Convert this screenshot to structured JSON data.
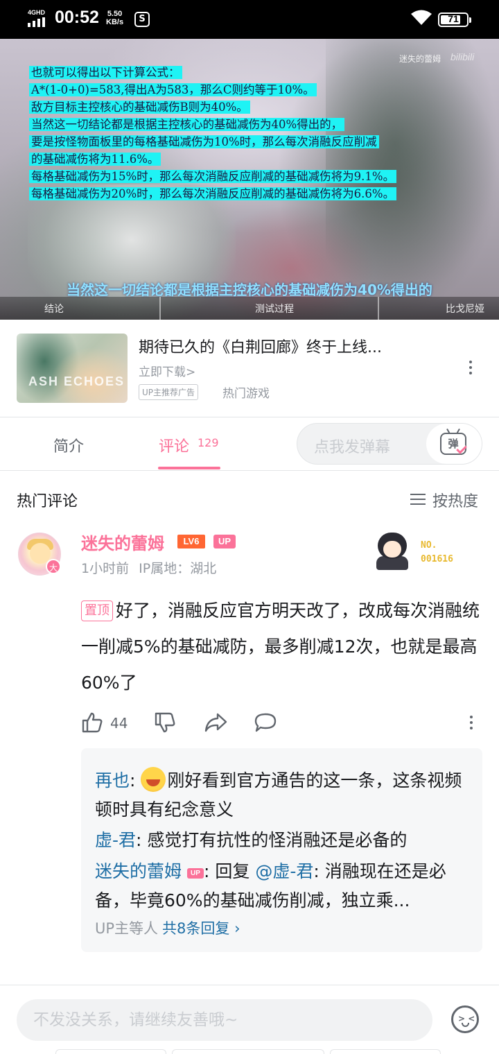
{
  "status_bar": {
    "network": "4GHD",
    "time": "00:52",
    "speed_value": "5.50",
    "speed_unit": "KB/s",
    "battery": "71"
  },
  "video": {
    "watermark": "迷失的蕾姆",
    "logo": "bilibili",
    "formula_lines": [
      "也就可以得出以下计算公式：",
      "A*(1-0+0)=583,得出A为583，那么C则约等于10%。",
      "敌方目标主控核心的基础减伤B则为40%。",
      "当然这一切结论都是根据主控核心的基础减伤为40%得出的，",
      "要是按怪物面板里的每格基础减伤为10%时，那么每次消融反应削减",
      "的基础减伤将为11.6%。",
      "每格基础减伤为15%时，那么每次消融反应削减的基础减伤将为9.1%。",
      "每格基础减伤为20%时，那么每次消融反应削减的基础减伤将为6.6%。"
    ],
    "subtitle": "当然这一切结论都是根据主控核心的基础减伤为40%得出的",
    "chapters": [
      "结论",
      "测试过程",
      "比戈尼娅"
    ]
  },
  "ad": {
    "thumb_text": "ASH ECHOES",
    "title": "期待已久的《白荆回廊》终于上线...",
    "link": "立即下载>",
    "tag": "UP主推荐广告",
    "category": "热门游戏"
  },
  "tabs": {
    "intro": "简介",
    "comments": "评论",
    "comment_count": "129",
    "danmaku_placeholder": "点我发弹幕",
    "danmaku_icon_text": "弹"
  },
  "comments_header": {
    "title": "热门评论",
    "sort": "按热度"
  },
  "comment": {
    "username": "迷失的蕾姆",
    "level": "LV6",
    "up_badge": "UP",
    "avatar_badge": "大",
    "time": "1小时前",
    "ip": "IP属地：湖北",
    "fan_no_label": "NO.",
    "fan_no": "001616",
    "pin_label": "置顶",
    "text": "好了，消融反应官方明天改了，改成每次消融统一削减5%的基础减防，最多削减12次，也就是最高60%了",
    "likes": "44"
  },
  "replies": [
    {
      "user": "再也",
      "text": "刚好看到官方通告的这一条，这条视频顿时具有纪念意义"
    },
    {
      "user": "虚-君",
      "text": "感觉打有抗性的怪消融还是必备的"
    },
    {
      "user": "迷失的蕾姆",
      "badge": "UP",
      "reply_prefix": "回复",
      "mention": "@虚-君",
      "text": "消融现在还是必备，毕竟60%的基础减伤削减，独立乘..."
    }
  ],
  "more_replies": {
    "prefix": "UP主等人",
    "link": "共8条回复 ›"
  },
  "input": {
    "placeholder": "不发没关系，请继续友善哦~"
  }
}
